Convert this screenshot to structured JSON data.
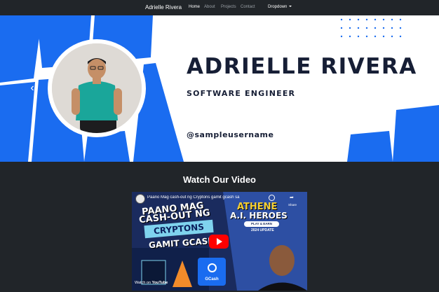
{
  "navbar": {
    "brand": "Adrielle Rivera",
    "links": [
      "Home",
      "About",
      "Projects",
      "Contact"
    ],
    "dropdown_label": "Dropdown"
  },
  "hero": {
    "name": "ADRIELLE RIVERA",
    "title": "SOFTWARE ENGINEER",
    "handle": "@sampleusername",
    "prev_icon": "chevron-left-icon"
  },
  "video_section": {
    "heading": "Watch Our Video",
    "video_title": "Paano Mag cash-out ng Cryptons gamit gcash sa",
    "share_label": "Share",
    "watch_on": "Watch on",
    "youtube_label": "YouTube",
    "thumbnail": {
      "line1": "PAANO MAG",
      "line2": "CASH-OUT NG",
      "line3": "CRYPTONS",
      "line4": "GAMIT GCASH",
      "game_main": "ATHENE",
      "game_sub": "A.I. HEROES",
      "game_pill": "PLAY & EARN",
      "game_year": "2024 UPDATE",
      "gcash_label": "GCash"
    }
  },
  "colors": {
    "navbar_bg": "#212529",
    "page_bg": "#212529",
    "hero_bg": "#ffffff",
    "accent_blue": "#1a6cf0",
    "name_color": "#161e35"
  }
}
